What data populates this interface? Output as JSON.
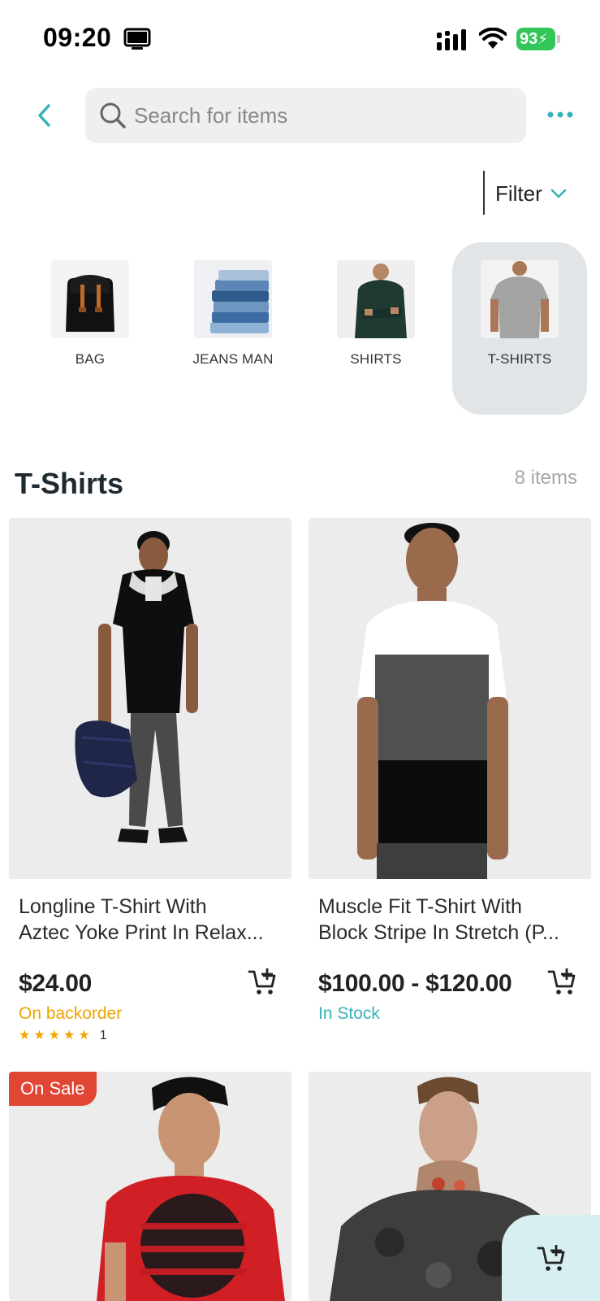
{
  "status_bar": {
    "time": "09:20",
    "battery": "93",
    "icons": [
      "screen-icon",
      "signal-icon",
      "wifi-icon",
      "battery-icon"
    ]
  },
  "header": {
    "search_placeholder": "Search for items",
    "icons": [
      "back-chevron-icon",
      "search-icon",
      "more-dots-icon"
    ]
  },
  "filter": {
    "label": "Filter"
  },
  "categories": [
    {
      "label": "BAG"
    },
    {
      "label": "JEANS MAN"
    },
    {
      "label": "SHIRTS"
    },
    {
      "label": "T-SHIRTS",
      "active": true
    }
  ],
  "section": {
    "title": "T-Shirts",
    "count": "8 items"
  },
  "products": [
    {
      "title_line1": "Longline T-Shirt With",
      "title_line2": "Aztec Yoke Print In Relax...",
      "price": "$24.00",
      "stock": "On backorder",
      "rating_count": "1",
      "stars": 5
    },
    {
      "title_line1": "Muscle Fit T-Shirt With",
      "title_line2": "Block Stripe In Stretch (P...",
      "price": "$100.00 - $120.00",
      "stock": "In Stock"
    },
    {
      "badge": "On Sale"
    },
    {}
  ],
  "colors": {
    "accent": "#36b3b8",
    "backorder": "#eca400",
    "in_stock": "#36b3b8",
    "sale": "#e14534",
    "star": "#f2a600"
  }
}
